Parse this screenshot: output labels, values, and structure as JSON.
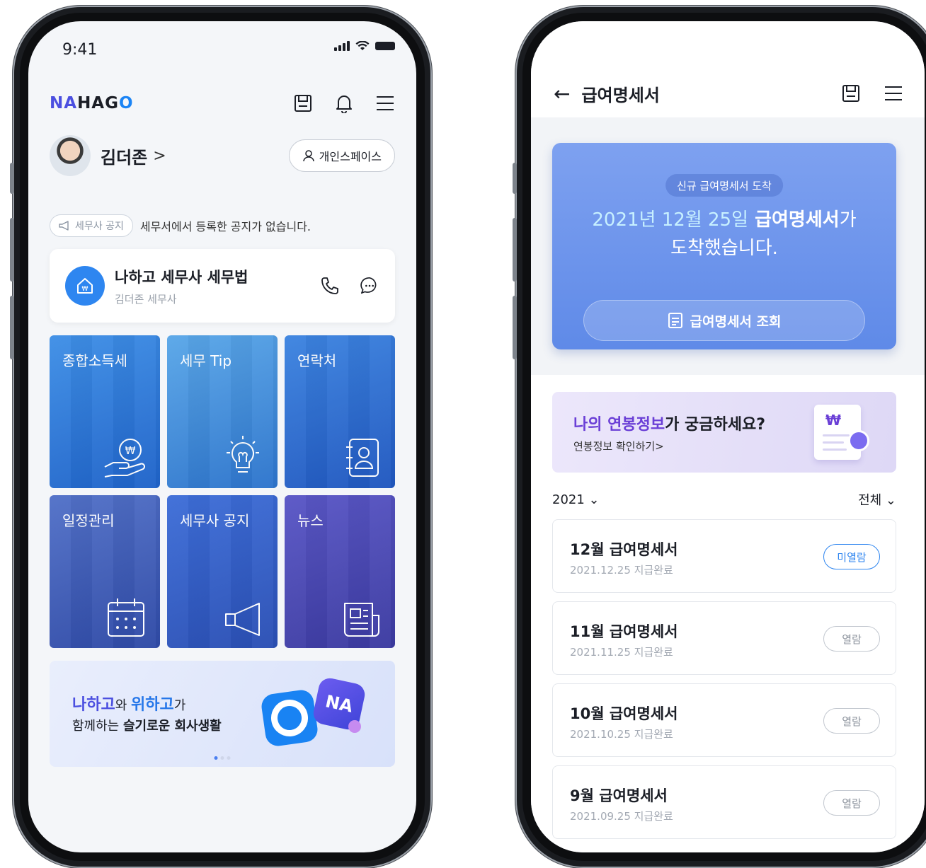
{
  "status": {
    "time": "9:41"
  },
  "home": {
    "logo": {
      "n1": "N",
      "a": "A",
      "mid": "HAG",
      "o": "O"
    },
    "user": {
      "name": "김더존",
      "chevron": ">"
    },
    "space_button": "개인스페이스",
    "notice": {
      "chip": "세무사 공지",
      "text": "세무서에서 등록한 공지가 없습니다."
    },
    "office": {
      "name": "나하고 세무사 세무법",
      "sub": "김더존 세무사"
    },
    "tiles": [
      {
        "label": "종합소득세",
        "icon": "coin-hand-icon"
      },
      {
        "label": "세무 Tip",
        "icon": "lightbulb-icon"
      },
      {
        "label": "연락처",
        "icon": "contact-book-icon"
      },
      {
        "label": "일정관리",
        "icon": "calendar-icon"
      },
      {
        "label": "세무사 공지",
        "icon": "megaphone-icon"
      },
      {
        "label": "뉴스",
        "icon": "newspaper-icon"
      }
    ],
    "banner": {
      "hl1": "나하고",
      "wa": "와 ",
      "hl2": "위하고",
      "ga": "가",
      "line2_pre": "함께하는 ",
      "line2_bold": "슬기로운 회사생활",
      "na": "NA"
    }
  },
  "payslip": {
    "title": "급여명세서",
    "back": "←",
    "hero": {
      "pill": "신규 급여명세서 도착",
      "date": "2021년 12월 25일",
      "title_bold": " 급여명세서",
      "suffix": "가",
      "line2": "도착했습니다.",
      "button": "급여명세서 조회"
    },
    "salary": {
      "hl": "나의 연봉정보",
      "rest": "가 궁금하세요?",
      "link": "연봉정보 확인하기>",
      "won": "₩"
    },
    "filter": {
      "year": "2021 ⌄",
      "scope": "전체 ⌄"
    },
    "items": [
      {
        "title": "12월 급여명세서",
        "sub": "2021.12.25 지급완료",
        "status": "미열람",
        "new": true
      },
      {
        "title": "11월 급여명세서",
        "sub": "2021.11.25 지급완료",
        "status": "열람",
        "new": false
      },
      {
        "title": "10월 급여명세서",
        "sub": "2021.10.25 지급완료",
        "status": "열람",
        "new": false
      },
      {
        "title": "9월 급여명세서",
        "sub": "2021.09.25 지급완료",
        "status": "열람",
        "new": false
      }
    ]
  },
  "colors": {
    "brand_blue": "#2f86f0",
    "brand_purple": "#4b4fe0",
    "hero_blue": "#6f95ec"
  }
}
